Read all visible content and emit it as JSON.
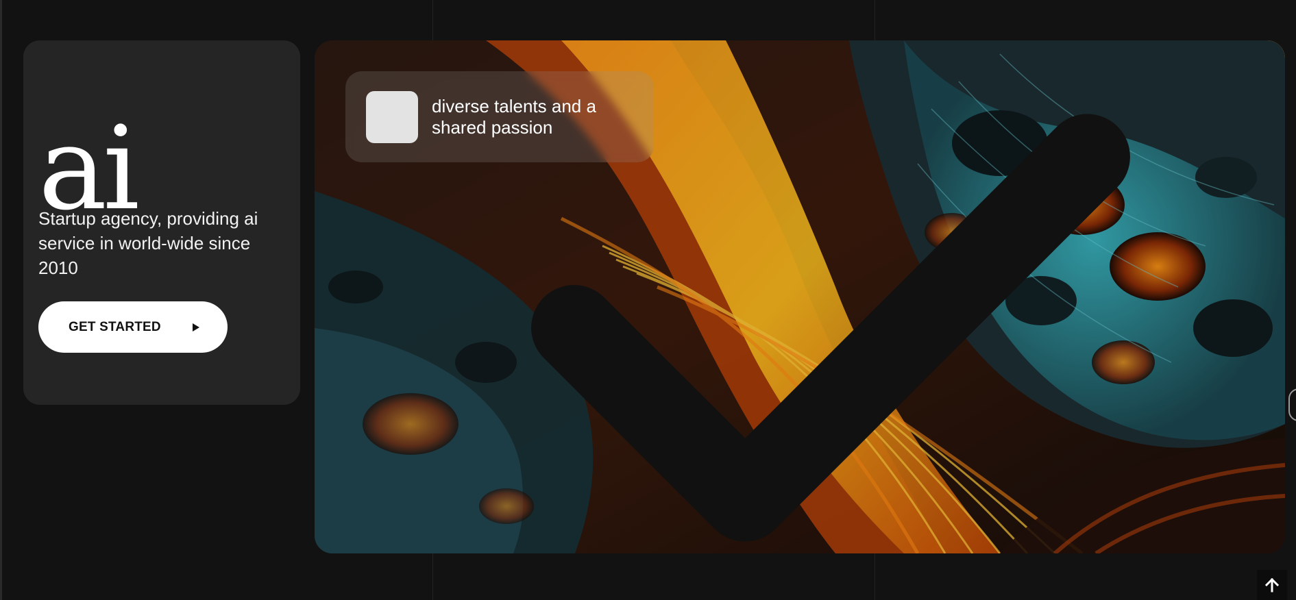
{
  "intro": {
    "logo_text": "ai",
    "tagline": "Startup agency, providing ai service in world-wide since 2010",
    "cta_label": "GET STARTED"
  },
  "hero": {
    "badge_text": "diverse talents and a shared passion",
    "image_description_icon": "abstract-art-image"
  },
  "icons": {
    "cta": "play-icon",
    "badge": "check-icon",
    "scroll": "arrow-up-icon"
  },
  "colors": {
    "background": "#121212",
    "card": "#252525",
    "button": "#ffffff",
    "accent_orange": "#f07a12",
    "accent_teal": "#2fa6b3"
  }
}
